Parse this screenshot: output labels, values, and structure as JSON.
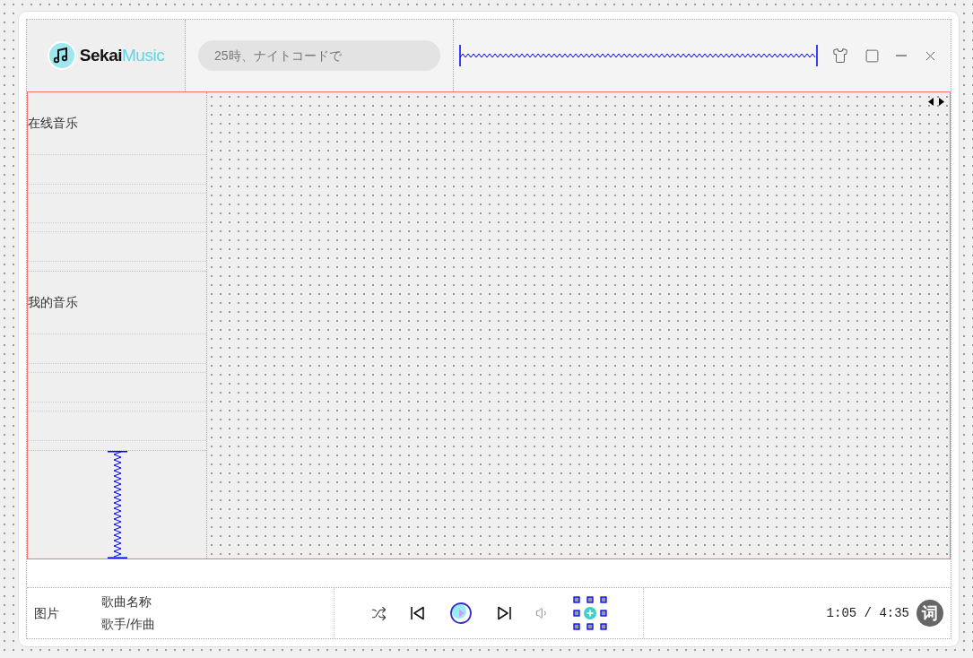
{
  "logo": {
    "brand_dark": "Sekai",
    "brand_light": "Music"
  },
  "search": {
    "placeholder": "25時、ナイトコードで"
  },
  "sidebar": {
    "sections": [
      {
        "title": "在线音乐"
      },
      {
        "title": "我的音乐"
      }
    ]
  },
  "player": {
    "cover": "图片",
    "song_title": "歌曲名称",
    "artist": "歌手/作曲",
    "time": "1:05 / 4:35",
    "lyrics_button": "词"
  }
}
